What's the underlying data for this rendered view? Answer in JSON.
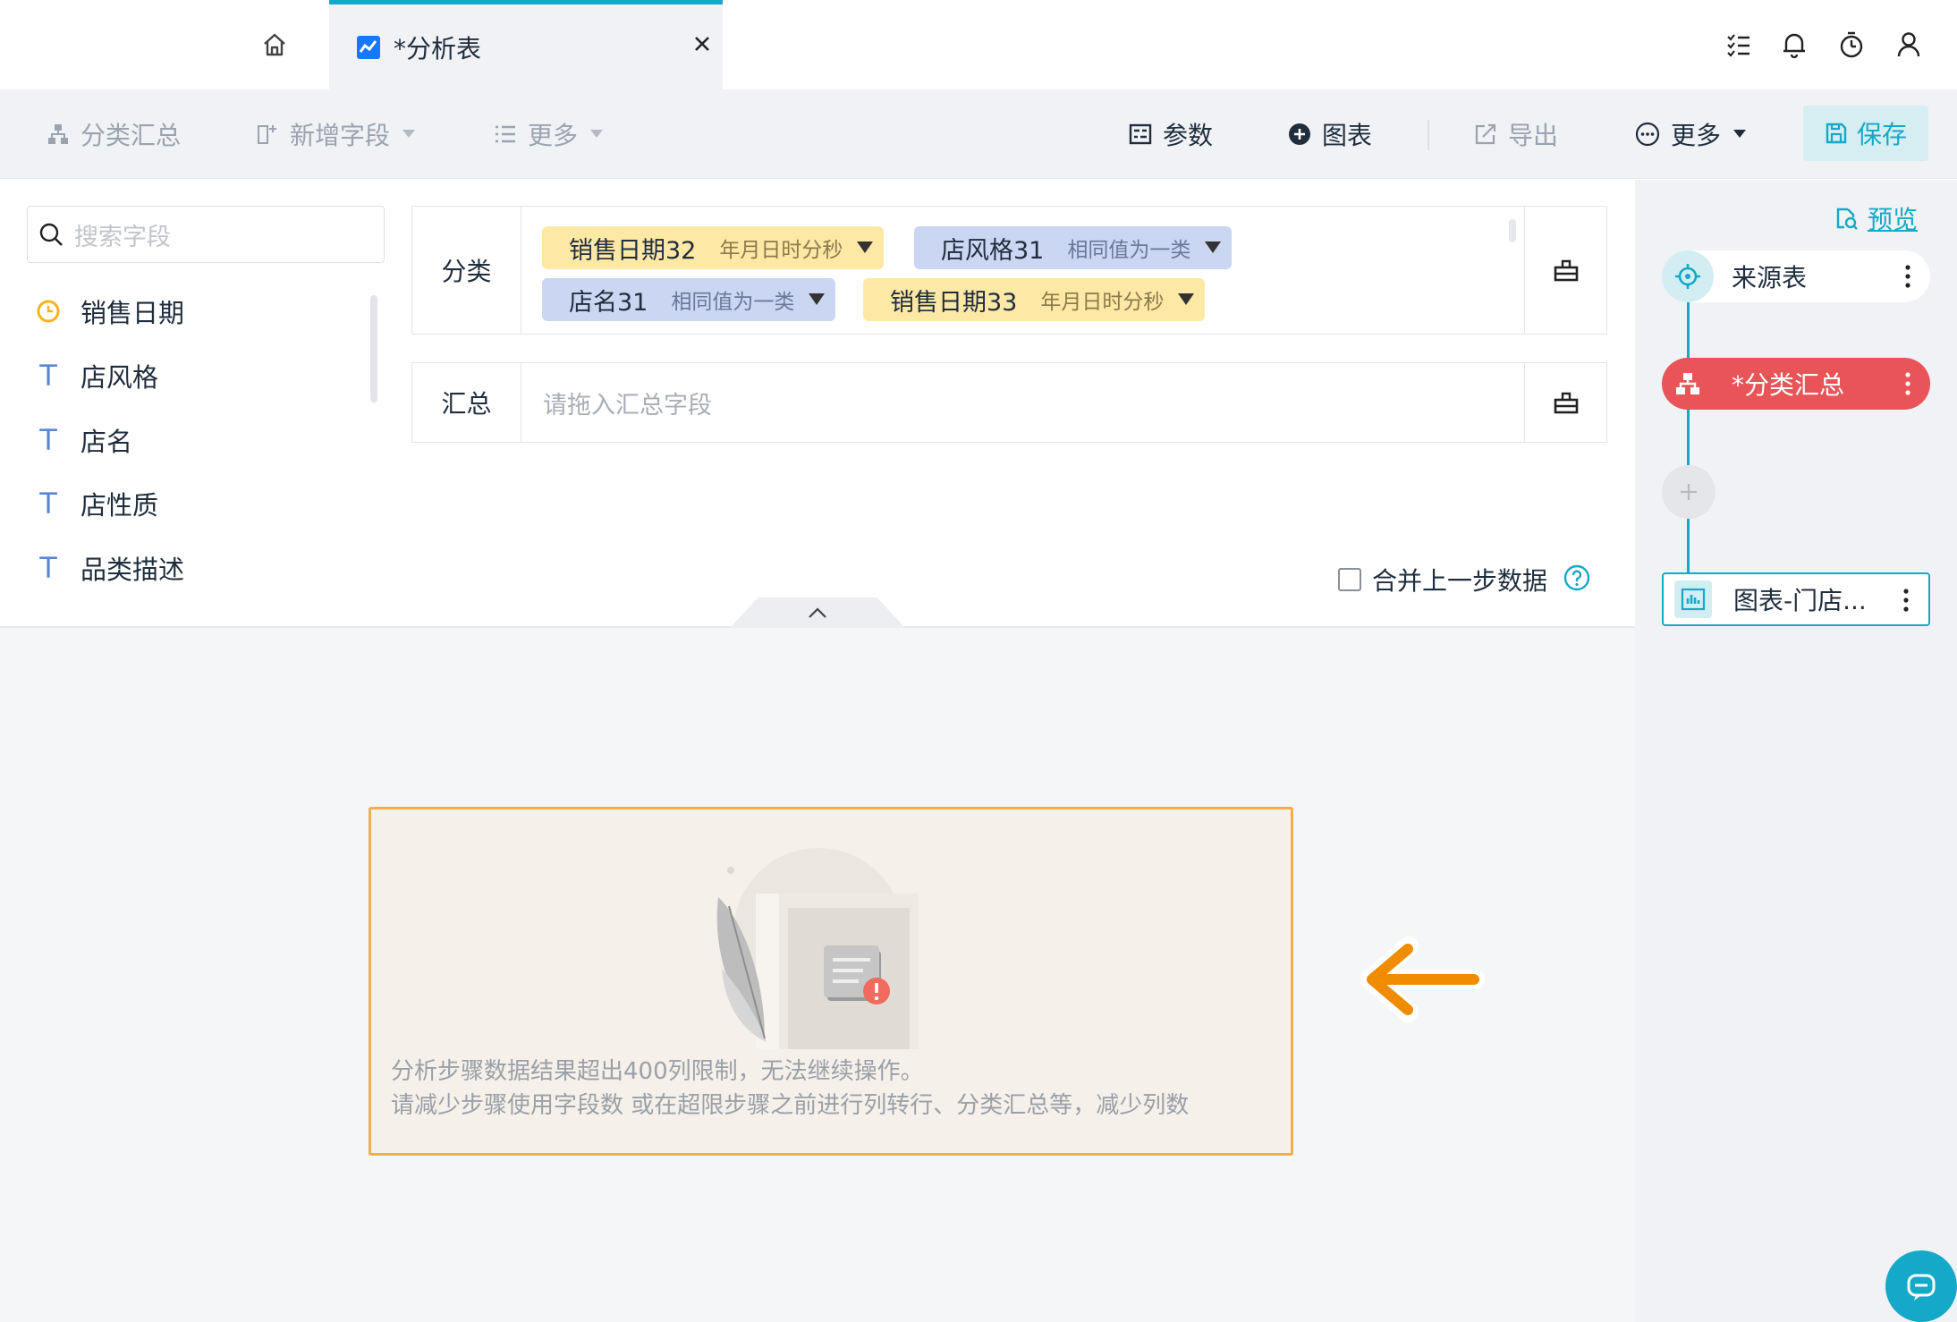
{
  "tabs": {
    "active_label": "*分析表"
  },
  "toolbar": {
    "classify_summary": "分类汇总",
    "add_field": "新增字段",
    "more_left": "更多",
    "params": "参数",
    "chart": "图表",
    "export": "导出",
    "more_right": "更多",
    "save": "保存"
  },
  "search": {
    "placeholder": "搜索字段"
  },
  "fields": [
    {
      "label": "销售日期",
      "type": "date"
    },
    {
      "label": "店风格",
      "type": "text"
    },
    {
      "label": "店名",
      "type": "text"
    },
    {
      "label": "店性质",
      "type": "text"
    },
    {
      "label": "品类描述",
      "type": "text"
    }
  ],
  "category_zone": {
    "label": "分类",
    "chips": [
      {
        "name": "销售日期32",
        "mode": "年月日时分秒",
        "color": "#fde8a5"
      },
      {
        "name": "店风格31",
        "mode": "相同值为一类",
        "color": "#cad6f2"
      },
      {
        "name": "店名31",
        "mode": "相同值为一类",
        "color": "#cad6f2"
      },
      {
        "name": "销售日期33",
        "mode": "年月日时分秒",
        "color": "#fde8a5"
      }
    ]
  },
  "summary_zone": {
    "label": "汇总",
    "placeholder": "请拖入汇总字段"
  },
  "merge": {
    "label": "合并上一步数据"
  },
  "error": {
    "line1": "分析步骤数据结果超出400列限制，无法继续操作。",
    "line2": "请减少步骤使用字段数 或在超限步骤之前进行列转行、分类汇总等，减少列数"
  },
  "flow": {
    "preview": "预览",
    "nodes": [
      {
        "label": "来源表"
      },
      {
        "label": "*分类汇总"
      },
      {
        "label": "图表-门店..."
      }
    ]
  },
  "colors": {
    "accent": "#14a9c8",
    "active_node": "#e85457",
    "error_border": "#f3ad4b",
    "arrow": "#f08c00"
  }
}
